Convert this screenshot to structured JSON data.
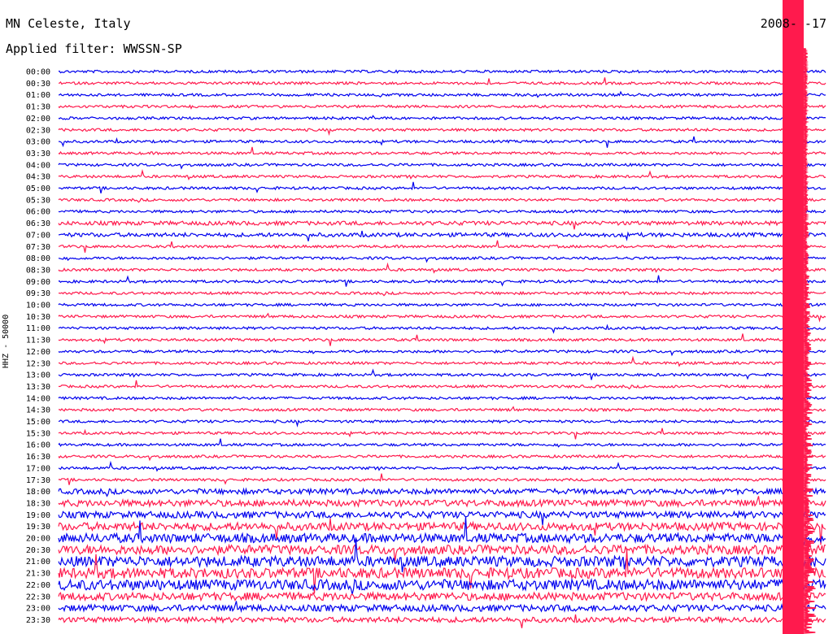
{
  "header": {
    "station": "MN Celeste, Italy",
    "date": "2008-   -17",
    "filter": "Applied filter: WWSSN-SP"
  },
  "chart_data": {
    "type": "line",
    "ylabel": "HHZ - 50000",
    "series_colors": [
      "#0000ee",
      "#ff1a4d"
    ],
    "time_labels": [
      "00:00",
      "00:30",
      "01:00",
      "01:30",
      "02:00",
      "02:30",
      "03:00",
      "03:30",
      "04:00",
      "04:30",
      "05:00",
      "05:30",
      "06:00",
      "06:30",
      "07:00",
      "07:30",
      "08:00",
      "08:30",
      "09:00",
      "09:30",
      "10:00",
      "10:30",
      "11:00",
      "11:30",
      "12:00",
      "12:30",
      "13:00",
      "13:30",
      "14:00",
      "14:30",
      "15:00",
      "15:30",
      "16:00",
      "16:30",
      "17:00",
      "17:30",
      "18:00",
      "18:30",
      "19:00",
      "19:30",
      "20:00",
      "20:30",
      "21:00",
      "21:30",
      "22:00",
      "22:30",
      "23:00",
      "23:30"
    ],
    "noise_levels": [
      1,
      1,
      1,
      1,
      1,
      1,
      1,
      1,
      1,
      1,
      1,
      1,
      1,
      1.5,
      1.5,
      1,
      1,
      1,
      1,
      1,
      1,
      1,
      1,
      1,
      1,
      1,
      1,
      1,
      1,
      1,
      1,
      1,
      1,
      1,
      1,
      1,
      2,
      2.5,
      2.5,
      3,
      3.5,
      3.5,
      4,
      4,
      4,
      3,
      2.5,
      2
    ]
  }
}
